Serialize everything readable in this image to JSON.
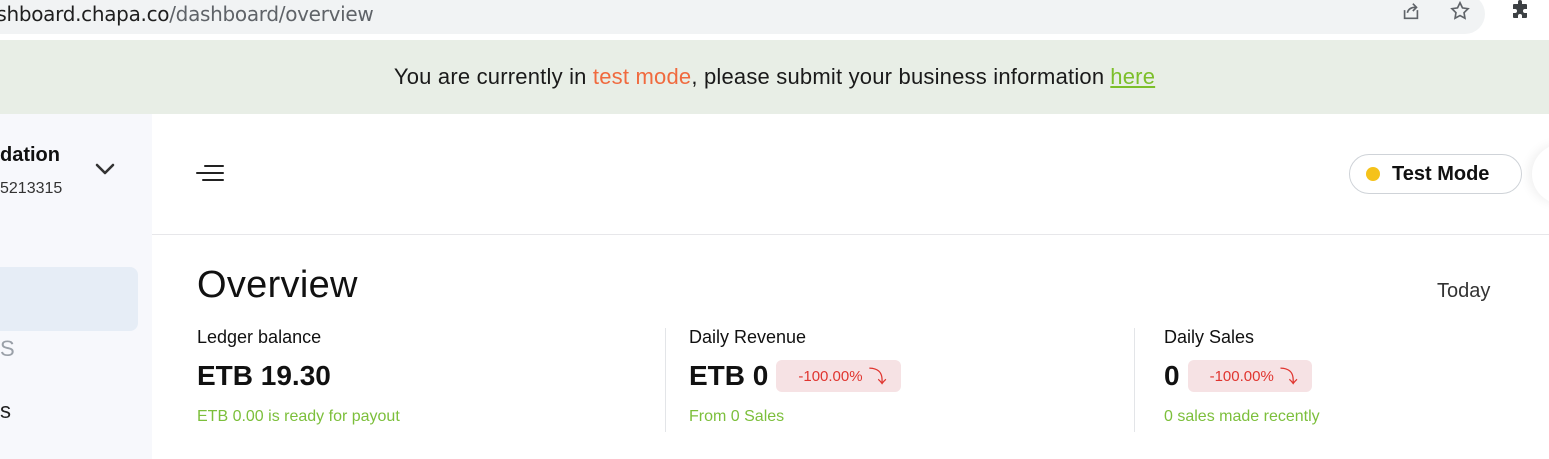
{
  "browser": {
    "url_host": "dashboard.chapa.co",
    "url_path": "/dashboard/overview"
  },
  "banner": {
    "prefix": "You are currently in ",
    "mode": "test mode",
    "middle": ", please submit your business information",
    "link": "here"
  },
  "sidebar": {
    "org_name": "dation",
    "org_phone": "5213315",
    "section_label": "S",
    "item_label": "s"
  },
  "header": {
    "mode_label": "Test Mode"
  },
  "overview": {
    "title": "Overview",
    "period": "Today",
    "stats": [
      {
        "label": "Ledger balance",
        "value": "ETB 19.30",
        "note": "ETB 0.00 is ready for payout"
      },
      {
        "label": "Daily Revenue",
        "value": "ETB 0",
        "change": "-100.00%",
        "note": "From 0 Sales"
      },
      {
        "label": "Daily Sales",
        "value": "0",
        "change": "-100.00%",
        "note": "0 sales made recently"
      }
    ]
  },
  "colors": {
    "accent_green": "#7cbf2a",
    "test_mode_orange": "#f06a3e",
    "negative_red": "#e0352f",
    "mode_dot": "#f5c21a"
  },
  "icons": [
    "share-icon",
    "star-icon",
    "extensions-icon",
    "chevron-down-icon",
    "menu-icon",
    "arrow-down-icon"
  ]
}
